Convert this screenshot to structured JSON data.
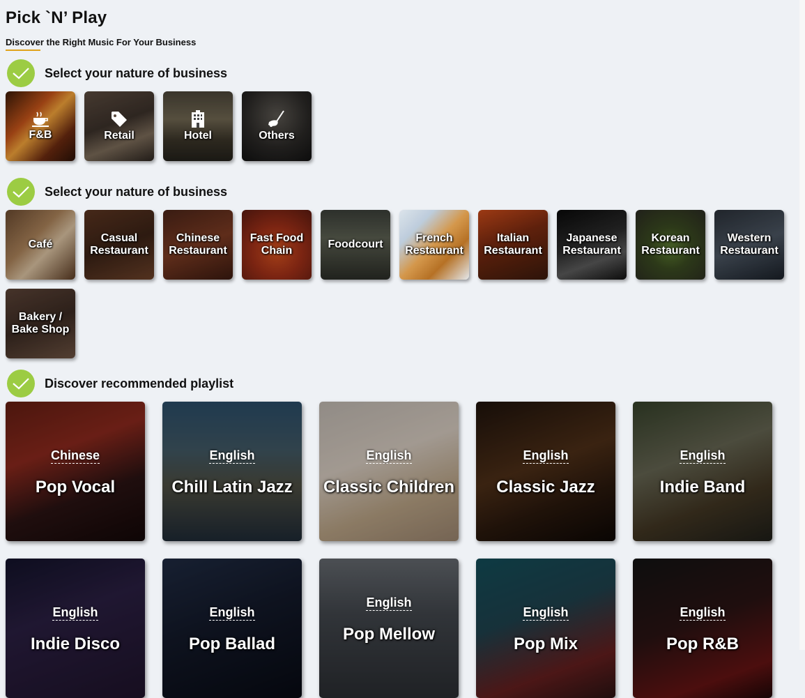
{
  "page": {
    "title": "Pick `N’ Play",
    "subtitle": "Discover the Right Music For Your Business"
  },
  "colors": {
    "accent": "#e0a21a",
    "check": "#9ccc43",
    "background": "#eef1f5"
  },
  "steps": [
    {
      "title": "Select your nature of business"
    },
    {
      "title": "Select your nature of business"
    },
    {
      "title": "Discover recommended playlist"
    }
  ],
  "business_types": [
    {
      "label": "F&B",
      "icon": "coffee-cup-icon"
    },
    {
      "label": "Retail",
      "icon": "price-tag-icon"
    },
    {
      "label": "Hotel",
      "icon": "building-icon"
    },
    {
      "label": "Others",
      "icon": "golf-club-icon"
    }
  ],
  "fnb_categories": [
    {
      "line1": "Café",
      "line2": ""
    },
    {
      "line1": "Casual",
      "line2": "Restaurant"
    },
    {
      "line1": "Chinese",
      "line2": "Restaurant"
    },
    {
      "line1": "Fast Food",
      "line2": "Chain"
    },
    {
      "line1": "Foodcourt",
      "line2": ""
    },
    {
      "line1": "French",
      "line2": "Restaurant"
    },
    {
      "line1": "Italian",
      "line2": "Restaurant"
    },
    {
      "line1": "Japanese",
      "line2": "Restaurant"
    },
    {
      "line1": "Korean",
      "line2": "Restaurant"
    },
    {
      "line1": "Western",
      "line2": "Restaurant"
    },
    {
      "line1": "Bakery /",
      "line2": "Bake Shop"
    }
  ],
  "playlists": [
    {
      "language": "Chinese",
      "name": "Pop Vocal"
    },
    {
      "language": "English",
      "name": "Chill Latin Jazz"
    },
    {
      "language": "English",
      "name": "Classic Children"
    },
    {
      "language": "English",
      "name": "Classic Jazz"
    },
    {
      "language": "English",
      "name": "Indie Band"
    },
    {
      "language": "English",
      "name": "Indie Disco"
    },
    {
      "language": "English",
      "name": "Pop Ballad"
    },
    {
      "language": "English",
      "name": "Pop Mellow"
    },
    {
      "language": "English",
      "name": "Pop Mix"
    },
    {
      "language": "English",
      "name": "Pop R&B"
    }
  ]
}
